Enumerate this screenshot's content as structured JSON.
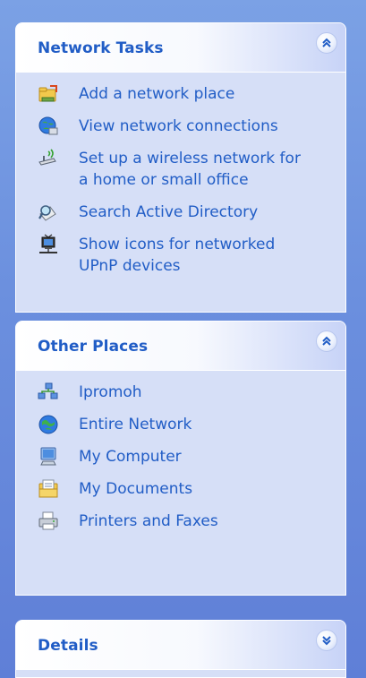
{
  "panels": {
    "network_tasks": {
      "title": "Network Tasks",
      "items": [
        {
          "label": "Add a network place",
          "icon": "add-network-place-icon"
        },
        {
          "label": "View network connections",
          "icon": "network-connections-icon"
        },
        {
          "label": "Set up a wireless network for a home or small office",
          "icon": "wireless-network-icon"
        },
        {
          "label": "Search Active Directory",
          "icon": "search-directory-icon"
        },
        {
          "label": "Show icons for networked UPnP devices",
          "icon": "upnp-devices-icon"
        }
      ]
    },
    "other_places": {
      "title": "Other Places",
      "items": [
        {
          "label": "Ipromoh",
          "icon": "workgroup-icon"
        },
        {
          "label": "Entire Network",
          "icon": "entire-network-icon"
        },
        {
          "label": "My Computer",
          "icon": "my-computer-icon"
        },
        {
          "label": "My Documents",
          "icon": "my-documents-icon"
        },
        {
          "label": "Printers and Faxes",
          "icon": "printers-faxes-icon"
        }
      ]
    },
    "details": {
      "title": "Details"
    }
  },
  "colors": {
    "link": "#215dc6",
    "panel_body": "#d6dff7",
    "background": "#6b8fde"
  }
}
